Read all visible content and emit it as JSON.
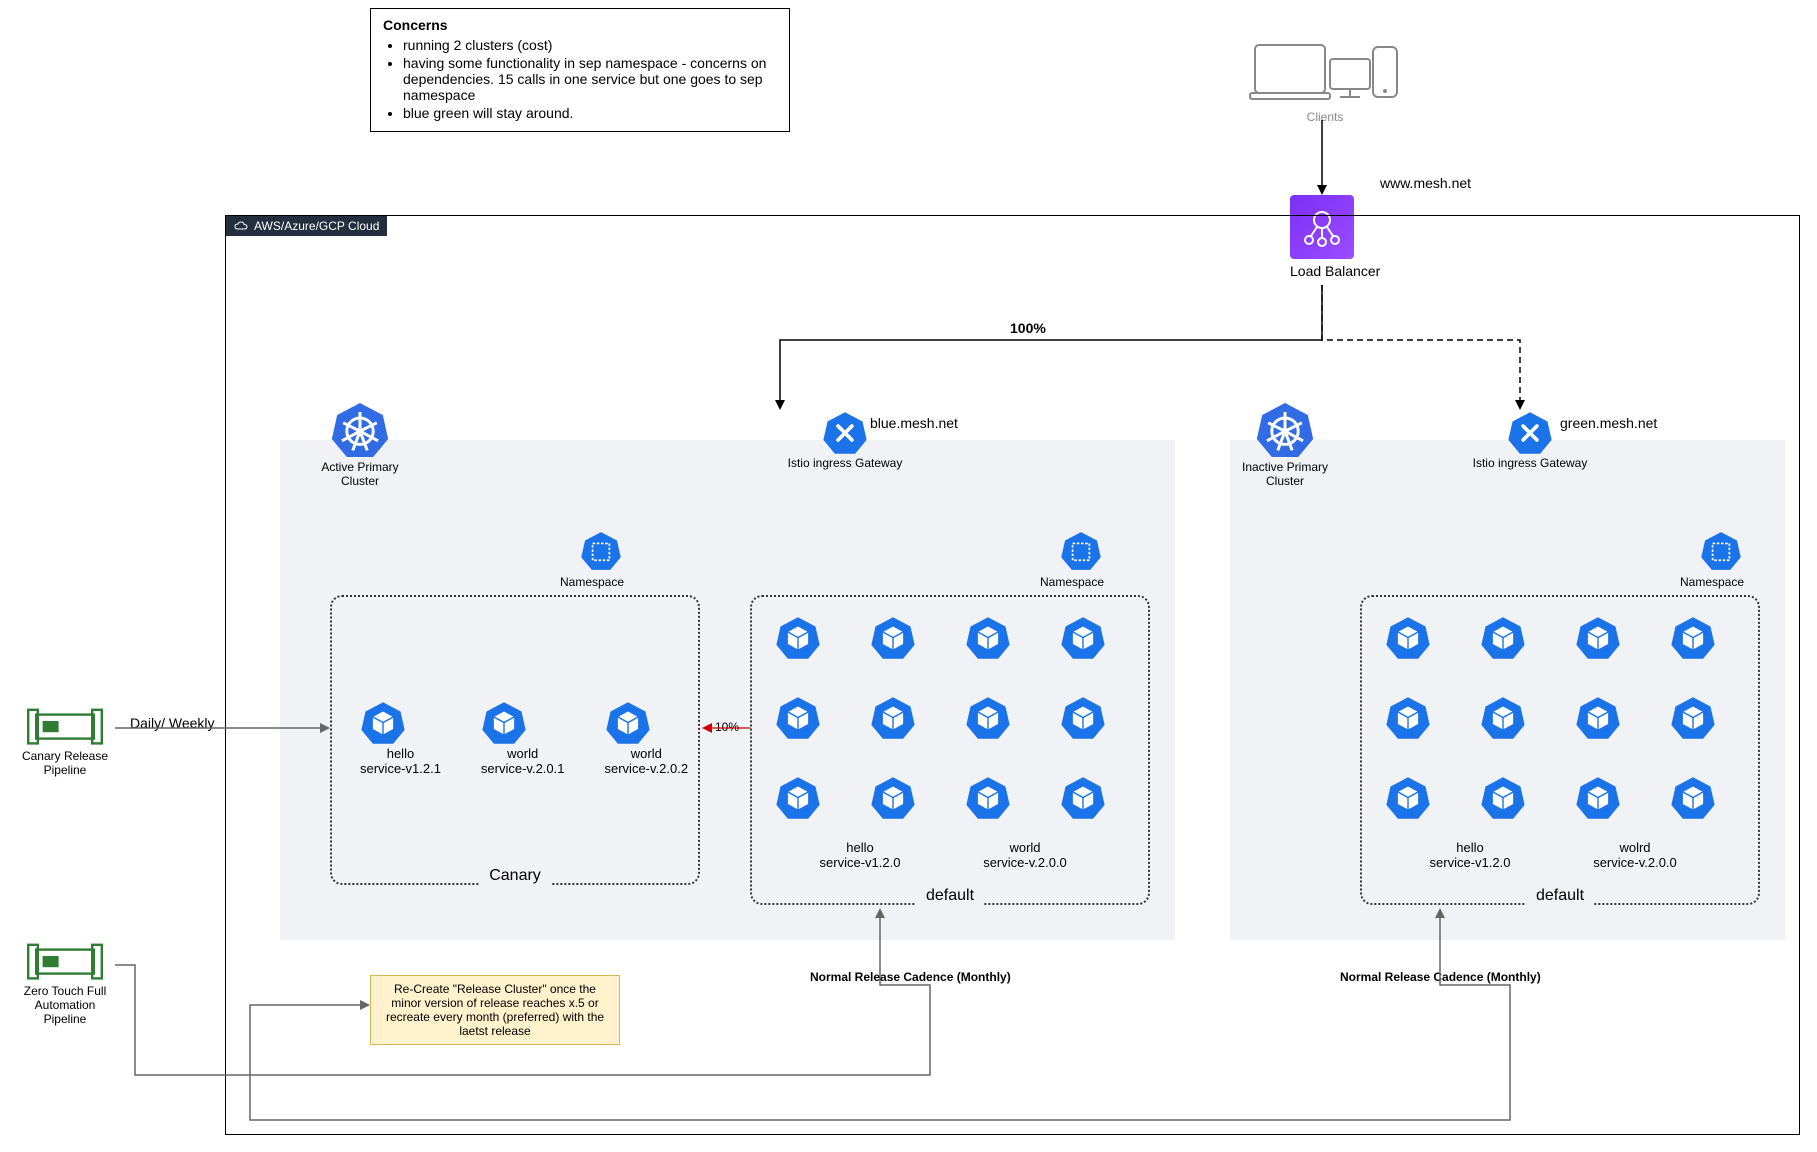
{
  "concerns": {
    "title": "Concerns",
    "items": [
      "running 2 clusters (cost)",
      "having some functionality in sep namespace - concerns on dependencies. 15 calls in one service but one goes to sep namespace",
      "blue green will stay around."
    ]
  },
  "clients_label": "Clients",
  "lb": {
    "label": "Load Balancer",
    "domain": "www.mesh.net"
  },
  "cloud_tag": "AWS/Azure/GCP Cloud",
  "traffic": {
    "main_pct": "100%",
    "canary_pct": "10%"
  },
  "blue": {
    "gateway_label": "Istio ingress Gateway",
    "domain": "blue.mesh.net",
    "cluster_label": "Active Primary Cluster",
    "ns_canary": {
      "name": "Canary",
      "label": "Namespace",
      "services": [
        {
          "name": "hello",
          "ver": "service-v1.2.1"
        },
        {
          "name": "world",
          "ver": "service-v.2.0.1"
        },
        {
          "name": "world",
          "ver": "service-v.2.0.2"
        }
      ]
    },
    "ns_default": {
      "name": "default",
      "label": "Namespace",
      "services": [
        {
          "name": "hello",
          "ver": "service-v1.2.0"
        },
        {
          "name": "world",
          "ver": "service-v.2.0.0"
        }
      ]
    }
  },
  "green": {
    "gateway_label": "Istio ingress Gateway",
    "domain": "green.mesh.net",
    "cluster_label": "Inactive Primary Cluster",
    "ns_default": {
      "name": "default",
      "label": "Namespace",
      "services": [
        {
          "name": "hello",
          "ver": "service-v1.2.0"
        },
        {
          "name": "wolrd",
          "ver": "service-v.2.0.0"
        }
      ]
    }
  },
  "pipelines": {
    "canary": {
      "label": "Canary Release Pipeline",
      "cadence": "Daily/ Weekly"
    },
    "zero_touch": {
      "label": "Zero Touch Full Automation Pipeline"
    }
  },
  "cadence_label": "Normal Release Cadence (Monthly)",
  "recreate_note": "Re-Create \"Release Cluster\" once the minor version of release reaches x.5 or recreate every month (preferred) with the laetst release"
}
